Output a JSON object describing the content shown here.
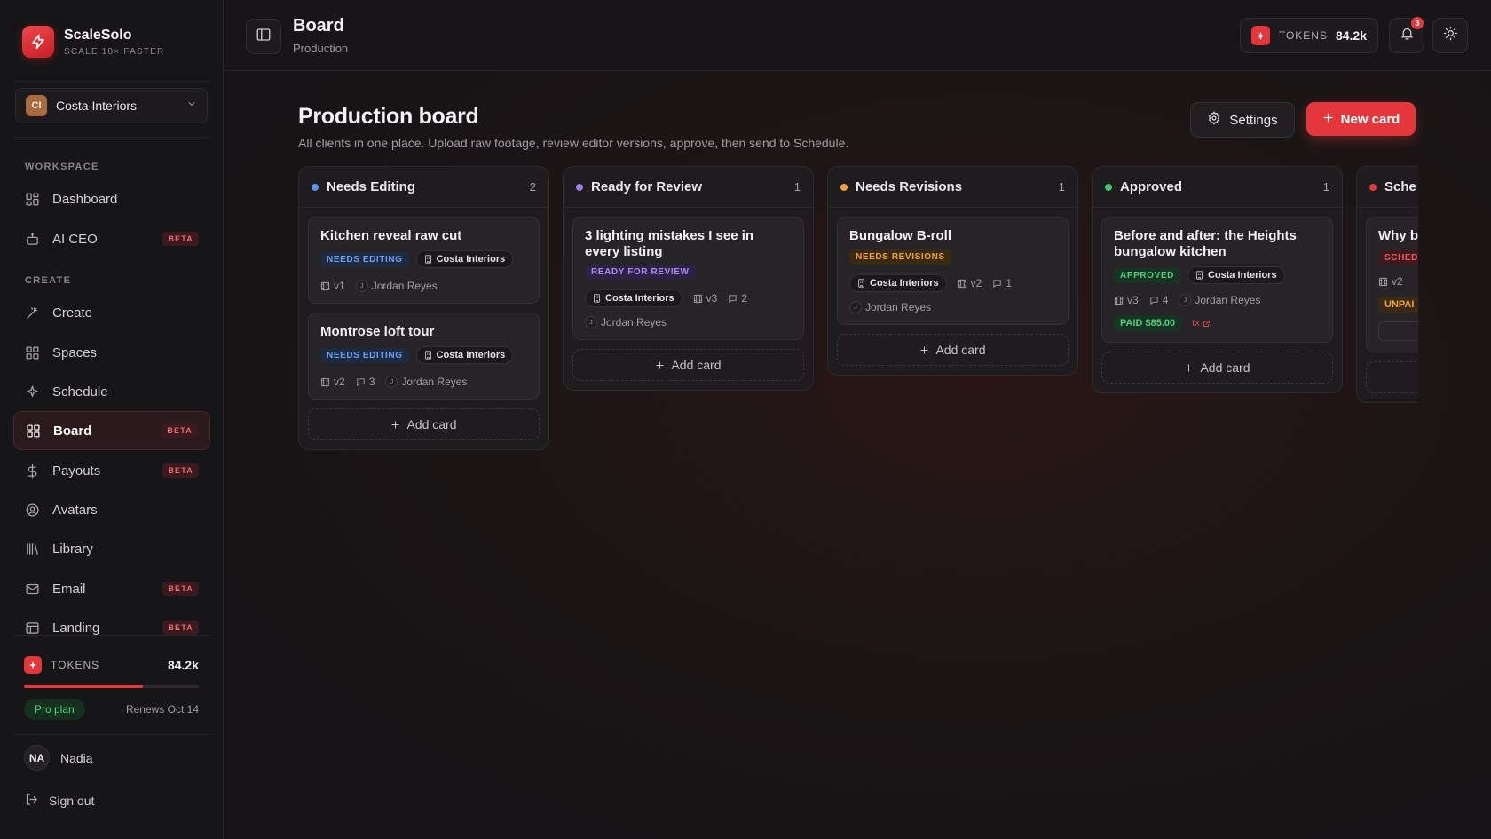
{
  "brand": {
    "name": "ScaleSolo",
    "tagline": "SCALE 10× FASTER"
  },
  "client_select": {
    "initials": "CI",
    "name": "Costa Interiors"
  },
  "sidebar": {
    "section_workspace": "WORKSPACE",
    "section_create": "CREATE",
    "items": [
      {
        "label": "Dashboard",
        "icon": "dashboard-icon"
      },
      {
        "label": "AI CEO",
        "icon": "robot-icon",
        "badge": "BETA"
      },
      {
        "label": "Create",
        "icon": "wand-icon"
      },
      {
        "label": "Spaces",
        "icon": "grid-icon"
      },
      {
        "label": "Schedule",
        "icon": "sparkle-icon"
      },
      {
        "label": "Board",
        "icon": "board-icon",
        "badge": "BETA",
        "active": true
      },
      {
        "label": "Payouts",
        "icon": "dollar-icon",
        "badge": "BETA"
      },
      {
        "label": "Avatars",
        "icon": "user-circle-icon"
      },
      {
        "label": "Library",
        "icon": "library-icon"
      },
      {
        "label": "Email",
        "icon": "mail-icon",
        "badge": "BETA"
      },
      {
        "label": "Landing",
        "icon": "layout-icon",
        "badge": "BETA"
      }
    ]
  },
  "tokens": {
    "label": "TOKENS",
    "value": "84.2k",
    "usage_fraction": 0.68
  },
  "plan": {
    "name": "Pro plan",
    "renews": "Renews Oct 14"
  },
  "user": {
    "initials": "NA",
    "name": "Nadia"
  },
  "signout": "Sign out",
  "topbar": {
    "title": "Board",
    "subtitle": "Production",
    "notifications": "3"
  },
  "board": {
    "title": "Production board",
    "description": "All clients in one place. Upload raw footage, review editor versions, approve, then send to Schedule.",
    "settings_label": "Settings",
    "new_card_label": "New card",
    "add_card_label": "Add card"
  },
  "colors": {
    "accent": "#e3373c",
    "needs_editing": "#5b8fe8",
    "ready_for_review": "#9a7be8",
    "needs_revisions": "#f0a23a",
    "approved": "#3fc26b",
    "scheduled": "#e5383d"
  },
  "columns": [
    {
      "name": "Needs Editing",
      "count": "2",
      "cards": [
        {
          "title": "Kitchen reveal raw cut",
          "status": "NEEDS EDITING",
          "client": "Costa Interiors",
          "version": "v1",
          "owner": "Jordan Reyes"
        },
        {
          "title": "Montrose loft tour",
          "status": "NEEDS EDITING",
          "client": "Costa Interiors",
          "version": "v2",
          "comments": "3",
          "owner": "Jordan Reyes"
        }
      ]
    },
    {
      "name": "Ready for Review",
      "count": "1",
      "cards": [
        {
          "title": "3 lighting mistakes I see in every listing",
          "status": "READY FOR REVIEW",
          "client": "Costa Interiors",
          "version": "v3",
          "comments": "2",
          "owner": "Jordan Reyes"
        }
      ]
    },
    {
      "name": "Needs Revisions",
      "count": "1",
      "cards": [
        {
          "title": "Bungalow B-roll",
          "status": "NEEDS REVISIONS",
          "client": "Costa Interiors",
          "version": "v2",
          "comments": "1",
          "owner": "Jordan Reyes"
        }
      ]
    },
    {
      "name": "Approved",
      "count": "1",
      "cards": [
        {
          "title": "Before and after: the Heights bungalow kitchen",
          "status": "APPROVED",
          "client": "Costa Interiors",
          "version": "v3",
          "comments": "4",
          "owner": "Jordan Reyes",
          "paid": "PAID $85.00",
          "tx": "tx"
        }
      ]
    },
    {
      "name": "Sche",
      "cards": [
        {
          "title": "Why b",
          "status": "SCHED",
          "version": "v2",
          "payment": "UNPAI"
        }
      ]
    }
  ]
}
